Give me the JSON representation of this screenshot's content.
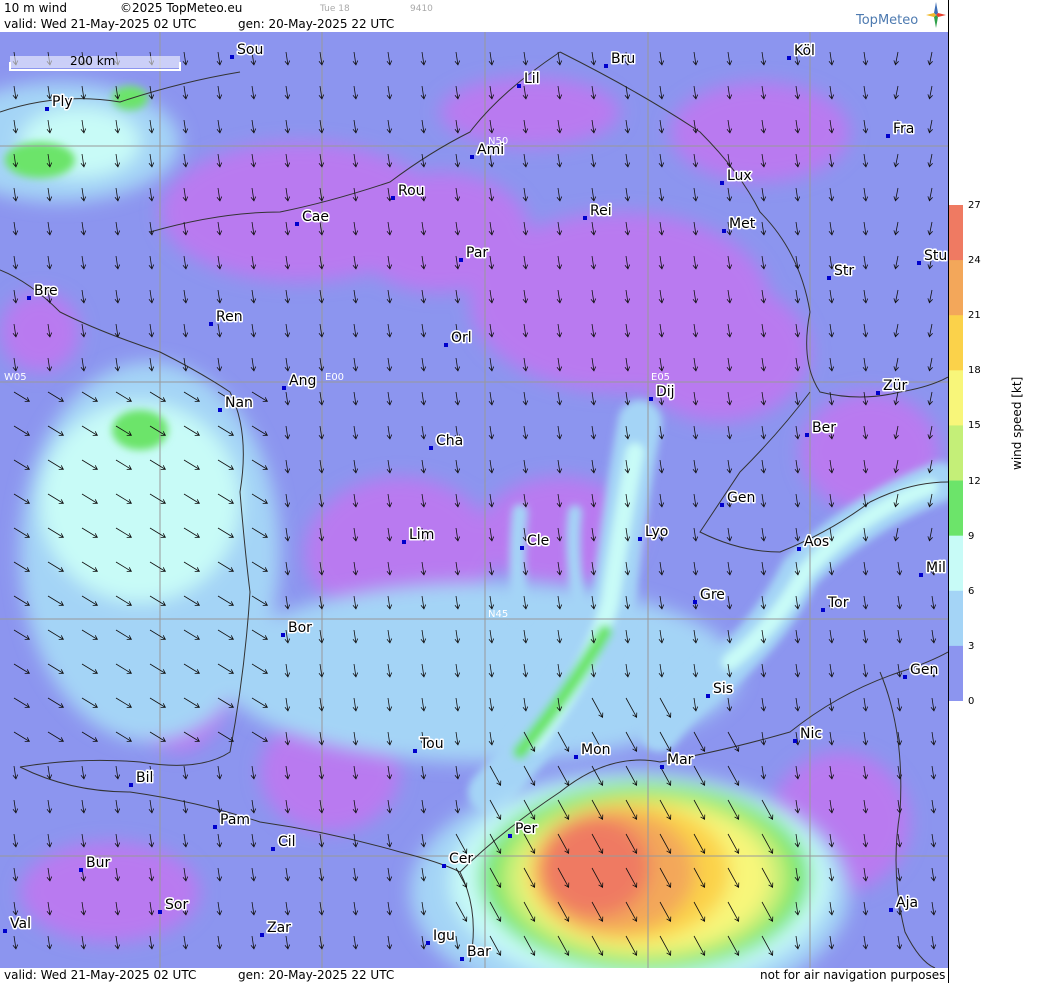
{
  "header": {
    "product": "10 m wind",
    "copyright": "©2025 TopMeteo.eu",
    "day_label": "Tue 18",
    "code": "9410",
    "valid": "valid:  Wed  21-May-2025  02 UTC",
    "generated": "gen: 20-May-2025 22 UTC",
    "brand": "TopMeteo"
  },
  "footer": {
    "valid": "valid:  Wed  21-May-2025  02 UTC",
    "generated": "gen: 20-May-2025 22 UTC",
    "disclaimer": "not for air navigation purposes"
  },
  "scale_bar": {
    "label": "200 km"
  },
  "grid_labels": {
    "lat_n50": "N50",
    "lat_n45": "N45",
    "lon_w05": "W05",
    "lon_e00": "E00",
    "lon_e05": "E05"
  },
  "colorbar": {
    "unit": "wind speed [kt]",
    "ticks": [
      "27",
      "24",
      "21",
      "18",
      "15",
      "12",
      "9",
      "6",
      "3",
      "0"
    ],
    "colors": [
      "#ef7a62",
      "#f3a75a",
      "#fbd24a",
      "#f8f67a",
      "#c4ef78",
      "#6ce46a",
      "#c8fbf7",
      "#a4d4f6",
      "#8c95ef",
      "#b97af0"
    ]
  },
  "cities": [
    {
      "label": "Sou"
    },
    {
      "label": "Bru"
    },
    {
      "label": "Köl"
    },
    {
      "label": "Ply"
    },
    {
      "label": "Lil"
    },
    {
      "label": "Fra"
    },
    {
      "label": "Ami"
    },
    {
      "label": "Lux"
    },
    {
      "label": "Rou"
    },
    {
      "label": "Cae"
    },
    {
      "label": "Rei"
    },
    {
      "label": "Met"
    },
    {
      "label": "Par"
    },
    {
      "label": "Stu"
    },
    {
      "label": "Str"
    },
    {
      "label": "Bre"
    },
    {
      "label": "Ren"
    },
    {
      "label": "Orl"
    },
    {
      "label": "Ang"
    },
    {
      "label": "Dij"
    },
    {
      "label": "Zür"
    },
    {
      "label": "Nan"
    },
    {
      "label": "Ber"
    },
    {
      "label": "Cha"
    },
    {
      "label": "Gen"
    },
    {
      "label": "Lim"
    },
    {
      "label": "Cle"
    },
    {
      "label": "Lyo"
    },
    {
      "label": "Aos"
    },
    {
      "label": "Mil"
    },
    {
      "label": "Gre"
    },
    {
      "label": "Tor"
    },
    {
      "label": "Bor"
    },
    {
      "label": "Gen"
    },
    {
      "label": "Sis"
    },
    {
      "label": "Tou"
    },
    {
      "label": "Mon"
    },
    {
      "label": "Nic"
    },
    {
      "label": "Mar"
    },
    {
      "label": "Bil"
    },
    {
      "label": "Pam"
    },
    {
      "label": "Per"
    },
    {
      "label": "Cil"
    },
    {
      "label": "Bur"
    },
    {
      "label": "Cer"
    },
    {
      "label": "Aja"
    },
    {
      "label": "Sor"
    },
    {
      "label": "Val"
    },
    {
      "label": "Zar"
    },
    {
      "label": "Igu"
    },
    {
      "label": "Bar"
    }
  ]
}
